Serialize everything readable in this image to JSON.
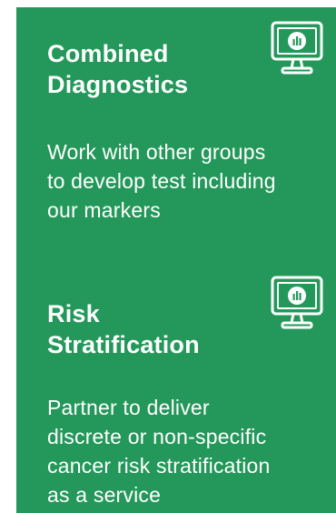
{
  "cards": [
    {
      "title_line1": "Combined",
      "title_line2": "Diagnostics",
      "desc_line1": "Work with other groups",
      "desc_line2": "to develop test including",
      "desc_line3": "our markers",
      "desc_line4": "",
      "icon": "monitor-chart-icon"
    },
    {
      "title_line1": "Risk",
      "title_line2": "Stratification",
      "desc_line1": "Partner to deliver",
      "desc_line2": "discrete or non-specific",
      "desc_line3": "cancer risk stratification",
      "desc_line4": "as a service",
      "icon": "monitor-chart-icon"
    }
  ],
  "colors": {
    "panel_bg": "#24985a",
    "text": "#ffffff"
  }
}
